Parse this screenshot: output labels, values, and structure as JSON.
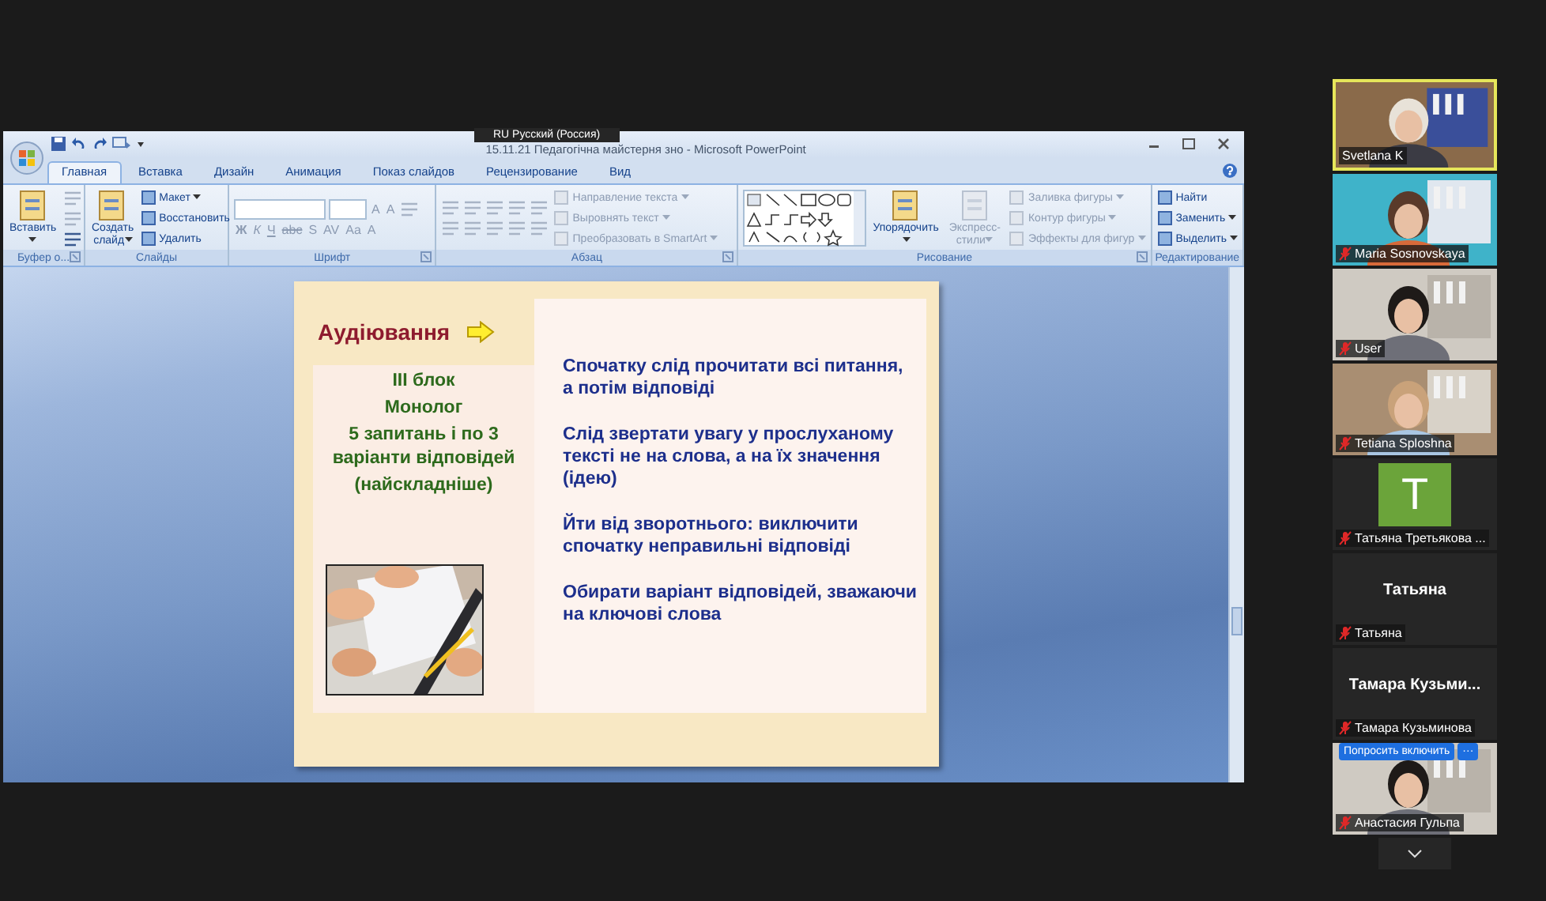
{
  "language_bar": {
    "label": "RU Русский (Россия)"
  },
  "window": {
    "title": "15.11.21 Педагогічна майстерня зно - Microsoft PowerPoint"
  },
  "tabs": [
    {
      "label": "Главная",
      "selected": true
    },
    {
      "label": "Вставка",
      "selected": false
    },
    {
      "label": "Дизайн",
      "selected": false
    },
    {
      "label": "Анимация",
      "selected": false
    },
    {
      "label": "Показ слайдов",
      "selected": false
    },
    {
      "label": "Рецензирование",
      "selected": false
    },
    {
      "label": "Вид",
      "selected": false
    }
  ],
  "ribbon": {
    "groups": [
      {
        "label": "Буфер о...",
        "launcher": true,
        "columns": [
          [
            {
              "kind": "large",
              "label": "Вставить",
              "dropdown": true,
              "disabled": false
            }
          ],
          [
            {
              "kind": "icon",
              "disabled": true
            },
            {
              "kind": "icon",
              "disabled": true
            },
            {
              "kind": "icon",
              "disabled": false
            }
          ]
        ]
      },
      {
        "label": "Слайды",
        "columns": [
          [
            {
              "kind": "large",
              "label": "Создать слайд",
              "dropdown": true,
              "disabled": false
            }
          ],
          [
            {
              "kind": "small",
              "label": "Макет",
              "dropdown": true,
              "disabled": false
            },
            {
              "kind": "small",
              "label": "Восстановить",
              "disabled": false
            },
            {
              "kind": "small",
              "label": "Удалить",
              "disabled": false
            }
          ]
        ]
      },
      {
        "label": "Шрифт",
        "launcher": true,
        "columns": [
          [
            {
              "kind": "row",
              "items": [
                {
                  "kind": "field"
                },
                {
                  "kind": "field"
                },
                {
                  "kind": "glyph",
                  "label": "A",
                  "disabled": true
                },
                {
                  "kind": "glyph",
                  "label": "A",
                  "disabled": true
                },
                {
                  "kind": "icon",
                  "disabled": true
                }
              ]
            },
            {
              "kind": "row",
              "items": [
                {
                  "kind": "glyph",
                  "label": "Ж",
                  "disabled": true
                },
                {
                  "kind": "glyph",
                  "label": "К",
                  "disabled": true
                },
                {
                  "kind": "glyph",
                  "label": "Ч",
                  "disabled": true
                },
                {
                  "kind": "glyph",
                  "label": "abc",
                  "disabled": true
                },
                {
                  "kind": "glyph",
                  "label": "S",
                  "disabled": true
                },
                {
                  "kind": "glyph",
                  "label": "AV",
                  "disabled": true
                },
                {
                  "kind": "glyph",
                  "label": "Aa",
                  "disabled": true
                },
                {
                  "kind": "glyph",
                  "label": "A",
                  "disabled": true
                }
              ]
            }
          ]
        ]
      },
      {
        "label": "Абзац",
        "launcher": true,
        "columns": [
          [
            {
              "kind": "row",
              "items": [
                {
                  "kind": "icon",
                  "disabled": true
                },
                {
                  "kind": "icon",
                  "disabled": true
                },
                {
                  "kind": "icon",
                  "disabled": true
                },
                {
                  "kind": "icon",
                  "disabled": true
                },
                {
                  "kind": "icon",
                  "disabled": true
                }
              ]
            },
            {
              "kind": "row",
              "items": [
                {
                  "kind": "icon",
                  "disabled": true
                },
                {
                  "kind": "icon",
                  "disabled": true
                },
                {
                  "kind": "icon",
                  "disabled": true
                },
                {
                  "kind": "icon",
                  "disabled": true
                },
                {
                  "kind": "icon",
                  "disabled": true
                }
              ]
            }
          ],
          [
            {
              "kind": "small",
              "label": "Направление текста",
              "dropdown": true,
              "disabled": true
            },
            {
              "kind": "small",
              "label": "Выровнять текст",
              "dropdown": true,
              "disabled": true
            },
            {
              "kind": "small",
              "label": "Преобразовать в SmartArt",
              "dropdown": true,
              "disabled": true
            }
          ]
        ]
      },
      {
        "label": "Рисование",
        "launcher": true,
        "columns": [
          [
            {
              "kind": "gallery"
            }
          ],
          [
            {
              "kind": "large",
              "label": "Упорядочить",
              "dropdown": true,
              "disabled": false
            }
          ],
          [
            {
              "kind": "large",
              "label": "Экспресс-стили",
              "dropdown": true,
              "disabled": true
            }
          ],
          [
            {
              "kind": "small",
              "label": "Заливка фигуры",
              "dropdown": true,
              "disabled": true
            },
            {
              "kind": "small",
              "label": "Контур фигуры",
              "dropdown": true,
              "disabled": true
            },
            {
              "kind": "small",
              "label": "Эффекты для фигур",
              "dropdown": true,
              "disabled": true
            }
          ]
        ]
      },
      {
        "label": "Редактирование",
        "columns": [
          [
            {
              "kind": "small",
              "label": "Найти",
              "disabled": false
            },
            {
              "kind": "small",
              "label": "Заменить",
              "dropdown": true,
              "disabled": false
            },
            {
              "kind": "small",
              "label": "Выделить",
              "dropdown": true,
              "disabled": false
            }
          ]
        ]
      }
    ]
  },
  "slide": {
    "heading": "Аудіювання",
    "left_lines": [
      "III блок",
      "Монолог",
      "5 запитань і по 3 варіанти відповідей",
      "(найскладніше)"
    ],
    "points": [
      "Спочатку слід прочитати всі питання, а потім відповіді",
      "Слід звертати увагу  у прослуханому тексті не на слова, а на їх значення (ідею)",
      "Йти від зворотнього: виключити спочатку неправильні відповіді",
      "Обирати варіант відповідей, зважаючи на ключові слова"
    ]
  },
  "participants": [
    {
      "kind": "video",
      "name": "Svetlana K",
      "muted": false,
      "speaking": true
    },
    {
      "kind": "video",
      "name": "Maria Sosnovskaya",
      "muted": true,
      "speaking": false
    },
    {
      "kind": "video",
      "name": "User",
      "muted": true,
      "speaking": false
    },
    {
      "kind": "video",
      "name": "Tetiana Sploshna",
      "muted": true,
      "speaking": false
    },
    {
      "kind": "avatar",
      "initial": "Т",
      "color": "#6ba43a",
      "name": "Татьяна Третьякова ...",
      "muted": true,
      "speaking": false
    },
    {
      "kind": "name",
      "display_name": "Татьяна",
      "name": "Татьяна",
      "muted": true,
      "speaking": false
    },
    {
      "kind": "name",
      "display_name": "Тамара  Кузьми...",
      "name": "Тамара Кузьминова",
      "muted": true,
      "speaking": false
    },
    {
      "kind": "video",
      "name": "Анастасия Гульпа",
      "muted": true,
      "speaking": false,
      "ask_button": "Попросить включить",
      "more_button": "···"
    }
  ]
}
